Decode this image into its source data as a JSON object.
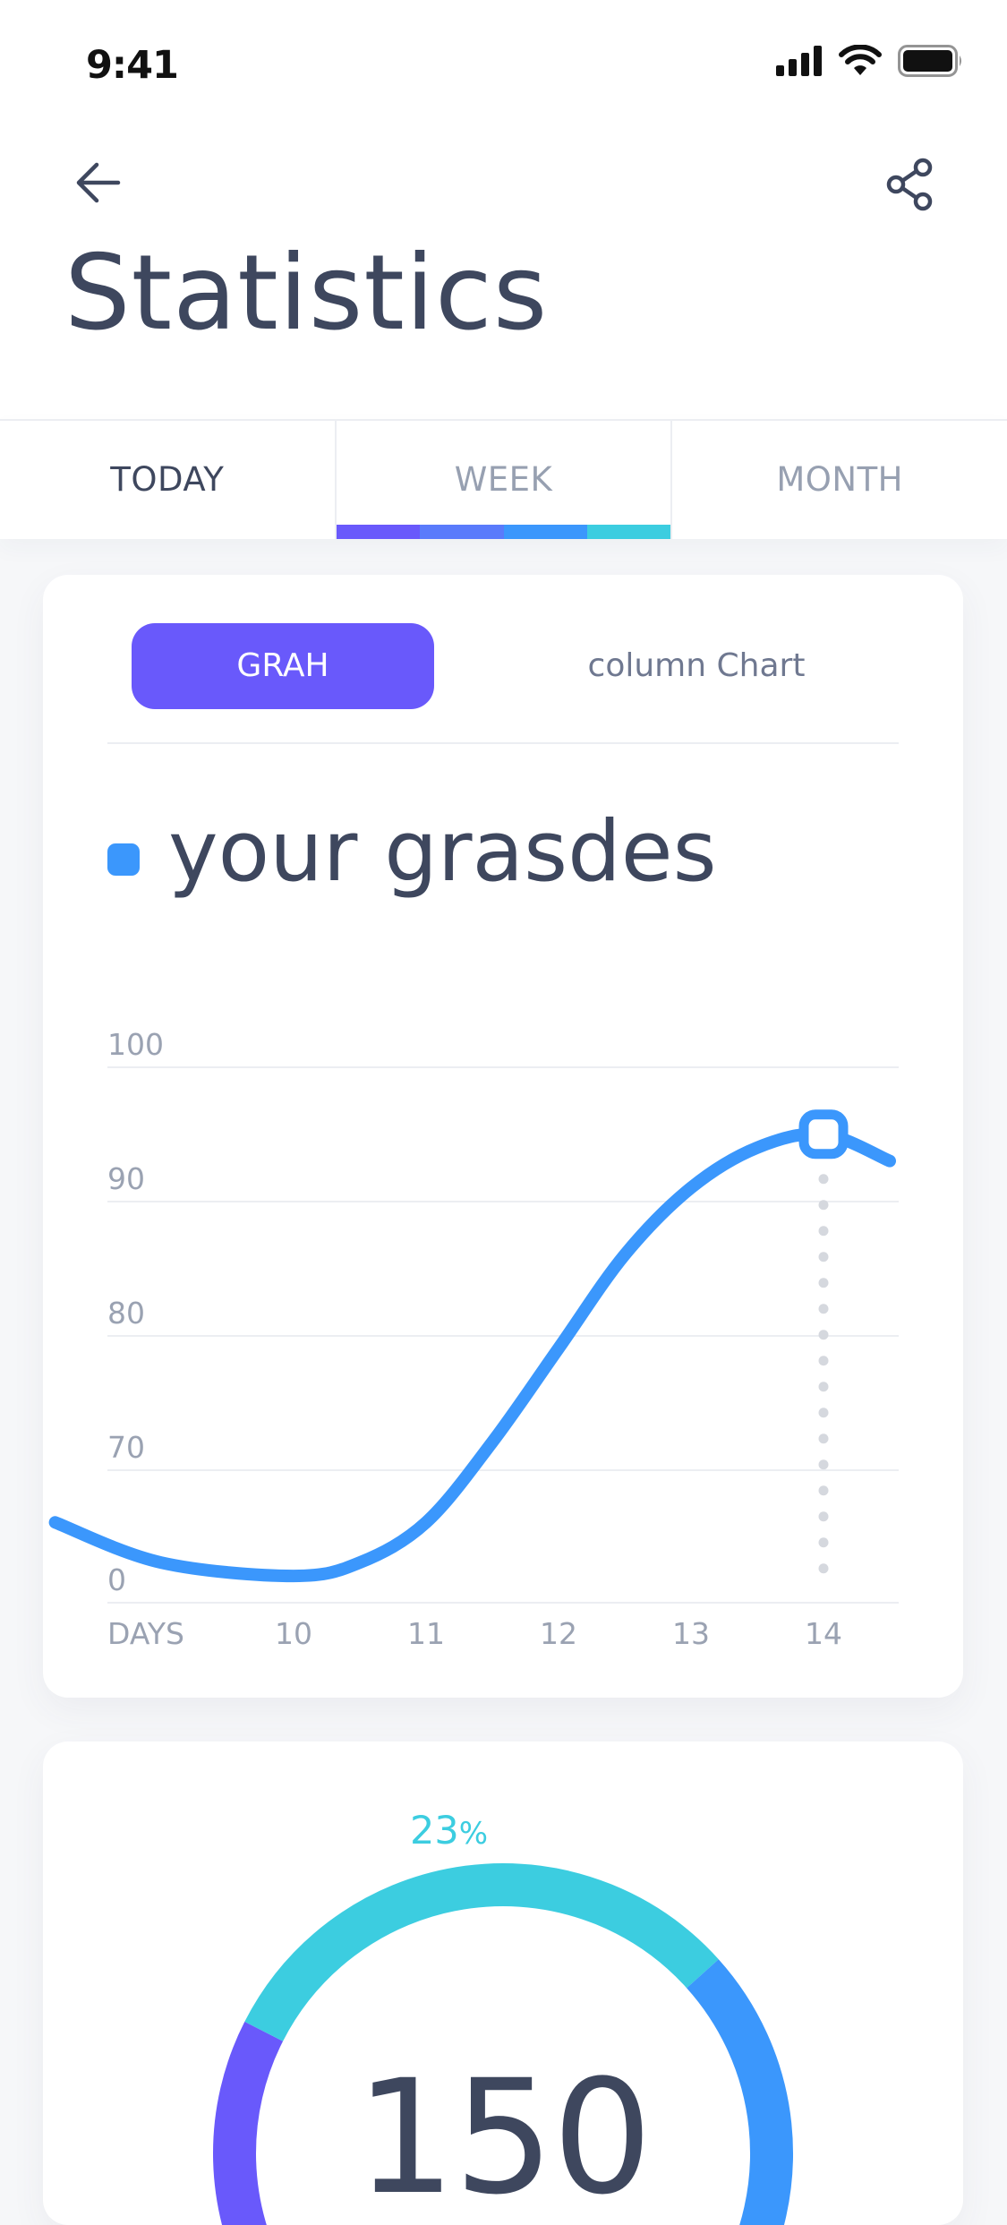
{
  "status_bar": {
    "time": "9:41",
    "icons": [
      "cellular-signal-icon",
      "wifi-icon",
      "battery-icon"
    ]
  },
  "header": {
    "back_icon": "arrow-left-icon",
    "share_icon": "share-icon",
    "title": "Statistics"
  },
  "tabs": {
    "items": [
      {
        "label": "TODAY"
      },
      {
        "label": "WEEK"
      },
      {
        "label": "MONTH"
      }
    ],
    "selected_index": 1,
    "underline_colors": [
      "#6959fb",
      "#5a7bfb",
      "#3b97fc",
      "#3ccde0"
    ]
  },
  "grades_card": {
    "toggle": {
      "active_label": "GRAH",
      "other_label": "column Chart"
    },
    "legend_label": "your grasdes",
    "accent_color": "#3b97fc",
    "chart_data": {
      "type": "line",
      "x_axis_label": "DAYS",
      "categories": [
        "10",
        "11",
        "12",
        "13",
        "14"
      ],
      "y_tick_labels": [
        "100",
        "90",
        "80",
        "70",
        "0"
      ],
      "series": [
        {
          "color": "#3b97fc",
          "x": [
            8.2,
            9.0,
            10.0,
            10.5,
            11.0,
            11.5,
            12.0,
            12.5,
            13.0,
            13.5,
            14.0,
            14.5
          ],
          "y": [
            66,
            63,
            62,
            63,
            66,
            72,
            79,
            86,
            91,
            94,
            95,
            93
          ]
        }
      ],
      "highlight": {
        "x": 14,
        "y": 95
      },
      "grid": true,
      "ylim": [
        60,
        100
      ],
      "legend": "top-left"
    }
  },
  "total_card": {
    "percent_value": "23",
    "percent_symbol": "%",
    "value": "150",
    "ring_colors": [
      "#6959fb",
      "#3ccde0",
      "#3b97fc"
    ]
  }
}
